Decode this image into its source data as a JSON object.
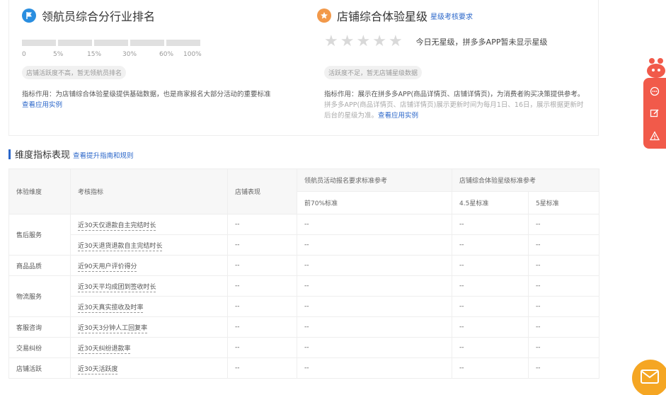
{
  "left_card": {
    "title": "领航员综合分行业排名",
    "ticks": [
      "0",
      "5%",
      "15%",
      "30%",
      "60%",
      "100%"
    ],
    "pill": "店铺活跃度不高，暂无领航员排名",
    "desc": "指标作用：为店铺综合体验星级提供基础数据，也是商家报名大部分活动的重要标准",
    "link": "查看应用实例"
  },
  "right_card": {
    "title": "店铺综合体验星级",
    "title_link": "星级考核要求",
    "star_note": "今日无星级，拼多多APP暂未显示星级",
    "stars": 5,
    "pill": "活跃度不足，暂无店铺星级数据",
    "desc_line1": "指标作用：展示在拼多多APP(商品详情页、店铺详情页)，为消费者购买决策提供参考。",
    "desc_line2": "拼多多APP(商品详情页、店铺详情页)展示更新时间为每月1日、16日，展示根据更新时",
    "desc_line3": "后台的星级为准。",
    "link": "查看应用实例"
  },
  "section": {
    "title": "维度指标表现",
    "link": "查看提升指南和规则"
  },
  "table": {
    "headers": {
      "dimension": "体验维度",
      "indicator": "考核指标",
      "shop": "店铺表现",
      "navigator_group": "领航员活动报名要求标准参考",
      "navigator_sub": "前70%标准",
      "star_group": "店铺综合体验星级标准参考",
      "star45": "4.5星标准",
      "star5": "5星标准"
    },
    "groups": [
      {
        "dimension": "售后服务",
        "rows": [
          {
            "indicator": "近30天仅退款自主完结时长",
            "shop": "--",
            "nav": "--",
            "s45": "--",
            "s5": "--"
          },
          {
            "indicator": "近30天退货退款自主完结时长",
            "shop": "--",
            "nav": "--",
            "s45": "--",
            "s5": "--"
          }
        ]
      },
      {
        "dimension": "商品品质",
        "rows": [
          {
            "indicator": "近90天用户评价得分",
            "shop": "--",
            "nav": "--",
            "s45": "--",
            "s5": "--"
          }
        ]
      },
      {
        "dimension": "物流服务",
        "rows": [
          {
            "indicator": "近30天平均成团到签收时长",
            "shop": "--",
            "nav": "--",
            "s45": "--",
            "s5": "--"
          },
          {
            "indicator": "近30天真实揽收及时率",
            "shop": "--",
            "nav": "--",
            "s45": "--",
            "s5": "--"
          }
        ]
      },
      {
        "dimension": "客服咨询",
        "rows": [
          {
            "indicator": "近30天3分钟人工回复率",
            "shop": "--",
            "nav": "--",
            "s45": "--",
            "s5": "--"
          }
        ]
      },
      {
        "dimension": "交易纠纷",
        "rows": [
          {
            "indicator": "近30天纠纷退款率",
            "shop": "--",
            "nav": "--",
            "s45": "--",
            "s5": "--"
          }
        ]
      },
      {
        "dimension": "店铺活跃",
        "rows": [
          {
            "indicator": "近30天活跃度",
            "shop": "--",
            "nav": "--",
            "s45": "--",
            "s5": "--"
          }
        ]
      }
    ]
  },
  "colors": {
    "accent_blue": "#2a66c9",
    "flag_icon": "#2a8ee0",
    "star_icon": "#f2994a",
    "side_tools": "#f15a4a",
    "mail_button": "#f5a623"
  },
  "icons": [
    "flag-icon",
    "medal-star-icon",
    "mascot-icon",
    "comment-icon",
    "edit-icon",
    "warning-icon",
    "mail-icon"
  ]
}
